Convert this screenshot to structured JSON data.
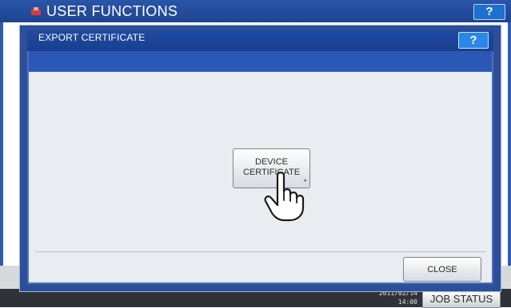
{
  "background": {
    "title": "USER FUNCTIONS",
    "help_label": "?",
    "job_status_label": "JOB STATUS",
    "clock_line1": "2011/02/14",
    "clock_line2": "14:00"
  },
  "dialog": {
    "title": "EXPORT CERTIFICATE",
    "help_label": "?",
    "device_certificate_line1": "DEVICE",
    "device_certificate_line2": "CERTIFICATE",
    "close_label": "CLOSE"
  },
  "colors": {
    "header_blue": "#1d4490",
    "dialog_blue": "#2b57b7",
    "help_blue": "#2a86e8",
    "panel_gray": "#e9ecf1"
  },
  "icons": [
    "user-functions-icon",
    "pointing-hand-icon",
    "submenu-arrow-icon"
  ]
}
